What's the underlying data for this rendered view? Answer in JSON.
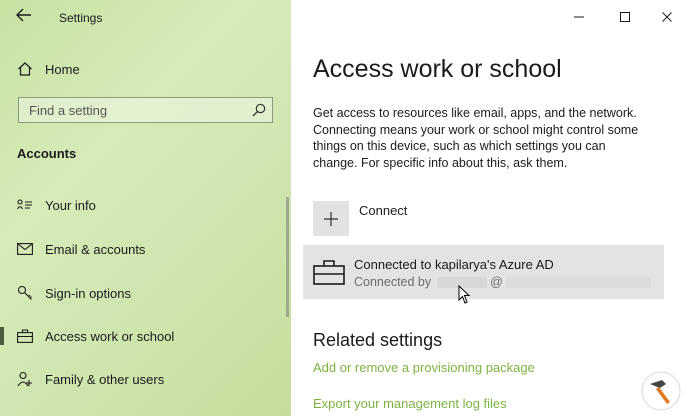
{
  "window": {
    "title": "Settings",
    "accent": "#4a5c3a",
    "link_color": "#7cb342",
    "controls": [
      "minimize-icon",
      "maximize-icon",
      "close-icon"
    ]
  },
  "sidebar": {
    "home_label": "Home",
    "search_placeholder": "Find a setting",
    "section_header": "Accounts",
    "items": [
      {
        "label": "Your info",
        "icon": "person-card-icon",
        "selected": false
      },
      {
        "label": "Email & accounts",
        "icon": "mail-icon",
        "selected": false
      },
      {
        "label": "Sign-in options",
        "icon": "key-icon",
        "selected": false
      },
      {
        "label": "Access work or school",
        "icon": "briefcase-icon",
        "selected": true
      },
      {
        "label": "Family & other users",
        "icon": "people-icon",
        "selected": false
      }
    ]
  },
  "main": {
    "title": "Access work or school",
    "description": "Get access to resources like email, apps, and the network. Connecting means your work or school might control some things on this device, such as which settings you can change. For specific info about this, ask them.",
    "connect_label": "Connect",
    "account": {
      "title": "Connected to kapilarya's Azure AD",
      "connected_by_prefix": "Connected by",
      "at_sign": "@"
    },
    "related_header": "Related settings",
    "links": [
      "Add or remove a provisioning package",
      "Export your management log files"
    ]
  }
}
